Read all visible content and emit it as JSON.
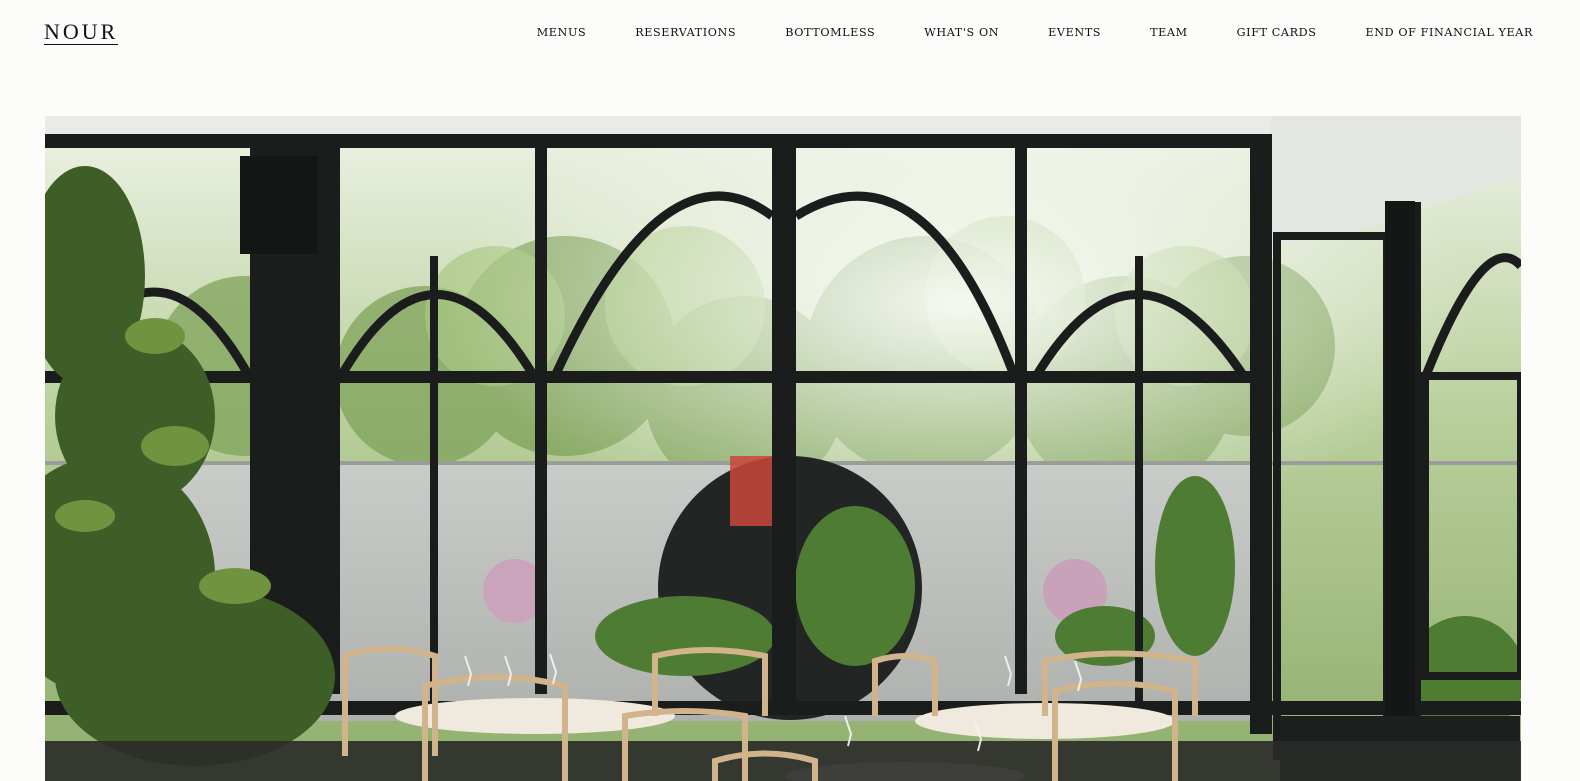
{
  "brand": {
    "logo_text": "NOUR"
  },
  "nav": {
    "items": [
      {
        "label": "MENUS",
        "name": "nav-menus"
      },
      {
        "label": "RESERVATIONS",
        "name": "nav-reservations"
      },
      {
        "label": "BOTTOMLESS",
        "name": "nav-bottomless"
      },
      {
        "label": "WHAT'S ON",
        "name": "nav-whats-on"
      },
      {
        "label": "EVENTS",
        "name": "nav-events"
      },
      {
        "label": "TEAM",
        "name": "nav-team"
      },
      {
        "label": "GIFT CARDS",
        "name": "nav-gift-cards"
      },
      {
        "label": "END OF FINANCIAL YEAR",
        "name": "nav-end-of-financial-year"
      }
    ]
  },
  "colors": {
    "background": "#fcfcfb",
    "text": "#111111",
    "frame": "#1b1d1c"
  }
}
